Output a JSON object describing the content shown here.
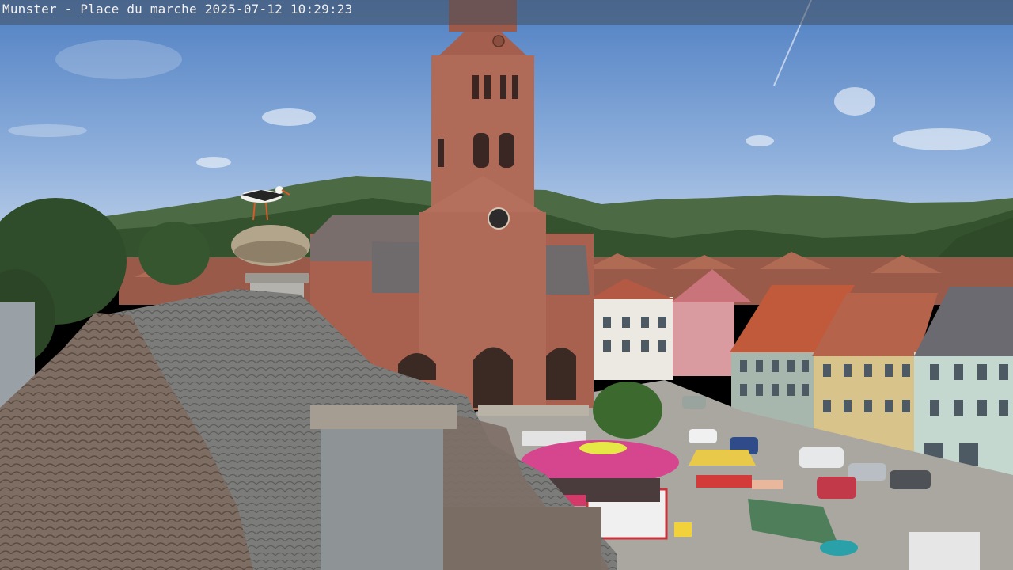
{
  "camera_overlay": {
    "caption": "Munster - Place du marche 2025-07-12 10:29:23"
  },
  "scene": {
    "subjects": [
      "church-tower",
      "stork-nest",
      "storks",
      "tiled-roofs",
      "market-umbrella",
      "market-stalls",
      "town-houses",
      "hills",
      "sky",
      "parked-cars",
      "tree"
    ],
    "colors": {
      "sky_top": "#5a86c4",
      "sky_bottom": "#a9c3e3",
      "hills": "#3f5d35",
      "church": "#a86252",
      "roof_tiles": "#7b6a5f",
      "umbrella": "#d4468e"
    }
  }
}
